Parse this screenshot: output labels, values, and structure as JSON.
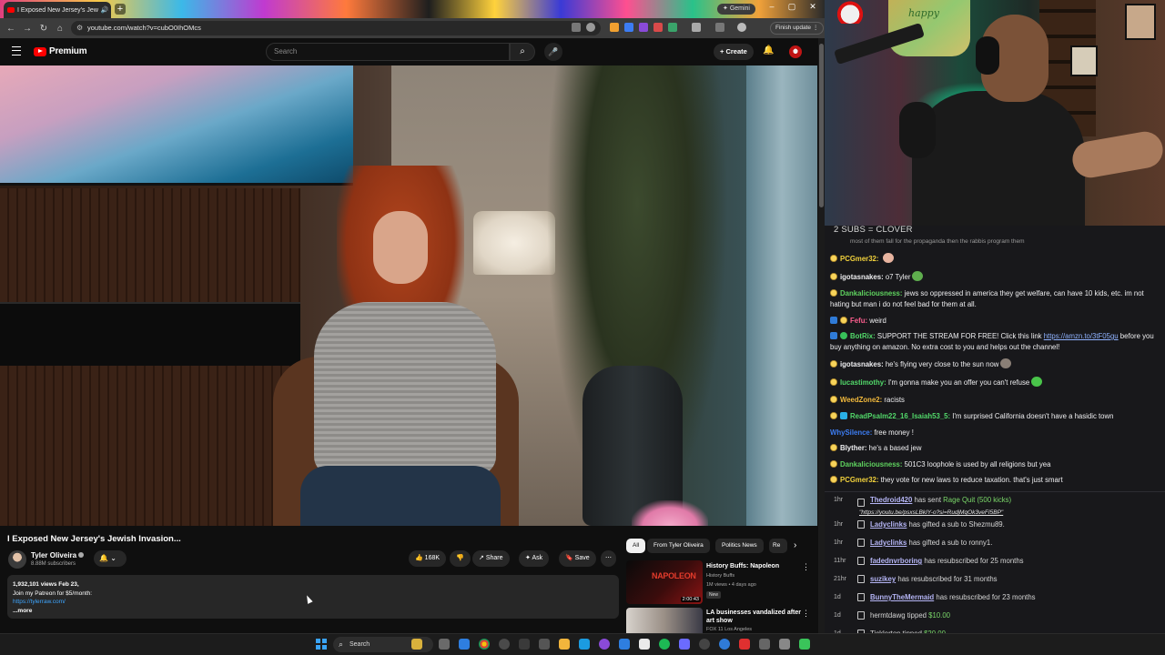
{
  "browser": {
    "tab_title": "I Exposed New Jersey's Jew",
    "url": "youtube.com/watch?v=cubO0IhOMcs",
    "gemini_label": "Gemini",
    "finish_update_label": "Finish update"
  },
  "youtube": {
    "logo_text": "Premium",
    "search_placeholder": "Search",
    "create_label": "Create",
    "video_title": "I Exposed New Jersey's Jewish Invasion...",
    "channel_name": "Tyler Oliveira",
    "channel_subs": "8.88M subscribers",
    "actions": {
      "likes": "168K",
      "share": "Share",
      "ask": "Ask",
      "save": "Save"
    },
    "description": {
      "meta": "1,932,101 views  Feb 23,",
      "line1": "Join my Patreon for $5/month:",
      "link": "https://tylerraw.com/",
      "more": "...more"
    },
    "chips": [
      "All",
      "From Tyler Oliveira",
      "Politics News",
      "Re"
    ],
    "recommendations": [
      {
        "title": "History Buffs: Napoleon",
        "channel": "History Buffs",
        "meta": "1M views • 4 days ago",
        "badge": "New",
        "duration": "2:00:43",
        "thumb_text": "NAPOLEON"
      },
      {
        "title": "LA businesses vandalized after art show",
        "channel": "FOX 11 Los Angeles",
        "meta": "",
        "badge": "",
        "duration": "",
        "thumb_text": ""
      }
    ]
  },
  "stream": {
    "webcam_sign": "happy",
    "chat_header": "2 SUBS = CLOVER",
    "clipped_line": "most of them fall for the propaganda then the rabbis program them",
    "messages": [
      {
        "badges": [
          "gold"
        ],
        "user": "PCGmer32:",
        "color": "#f2d23c",
        "text": "",
        "emote": "#e8b4a0"
      },
      {
        "badges": [
          "gold"
        ],
        "user": "igotasnakes:",
        "color": "#efeff1",
        "text": "o7 Tyler",
        "emote": "#5fae4e"
      },
      {
        "badges": [
          "gold"
        ],
        "user": "Dankaliciousness:",
        "color": "#5fd35f",
        "text": "jews so oppressed in america they get welfare, can have 10 kids, etc. im not hating but man i do not feel bad for them at all.",
        "emote": ""
      },
      {
        "badges": [
          "blue",
          "gold"
        ],
        "user": "Fefu:",
        "color": "#ff5f8f",
        "text": "weird",
        "emote": ""
      },
      {
        "badges": [
          "blue",
          "green"
        ],
        "user": "BotRix:",
        "color": "#52d96a",
        "text": "SUPPORT THE STREAM FOR FREE! Click this link ",
        "link": "https://amzn.to/3tF05gu",
        "text2": " before you buy anything on amazon. No extra cost to you and helps out the channel!",
        "emote": ""
      },
      {
        "badges": [
          "gold"
        ],
        "user": "igotasnakes:",
        "color": "#efeff1",
        "text": "he's flying very close to the sun now",
        "emote": "#8a7f76"
      },
      {
        "badges": [
          "gold"
        ],
        "user": "lucastimothy:",
        "color": "#52d96a",
        "text": "I'm gonna make you an offer you can't refuse",
        "emote": "#49c44a"
      },
      {
        "badges": [
          "gold"
        ],
        "user": "WeedZone2:",
        "color": "#f2b93c",
        "text": "racists",
        "emote": ""
      },
      {
        "badges": [
          "gold",
          "cyan"
        ],
        "user": "ReadPsalm22_16_Isaiah53_5:",
        "color": "#52d96a",
        "text": "I'm surprised California doesn't have a hasidic town",
        "emote": ""
      },
      {
        "badges": [],
        "user": "WhySilence:",
        "color": "#3c7cf2",
        "text": "free money !",
        "emote": ""
      },
      {
        "badges": [
          "gold"
        ],
        "user": "Blyther:",
        "color": "#efeff1",
        "text": "he's a based jew",
        "emote": ""
      },
      {
        "badges": [
          "gold"
        ],
        "user": "Dankaliciousness:",
        "color": "#5fd35f",
        "text": "501C3 loophole is used by all religions but yea",
        "emote": ""
      },
      {
        "badges": [
          "gold"
        ],
        "user": "PCGmer32:",
        "color": "#f2d23c",
        "text": "they vote for new laws to reduce taxation. that's just smart",
        "emote": ""
      }
    ],
    "events": [
      {
        "time": "1hr",
        "user": "Thedroid420",
        "before": "",
        "text": " has sent ",
        "highlight": "Rage Quit (500 kicks)",
        "sub": "\"https://youtu.be/psxsLBkIY-o?si=RudjMqOk3veFI5BP\""
      },
      {
        "time": "1hr",
        "user": "Ladyclinks",
        "before": "",
        "text": " has gifted a sub to Shezmu89.",
        "highlight": "",
        "sub": ""
      },
      {
        "time": "1hr",
        "user": "Ladyclinks",
        "before": "",
        "text": " has gifted a sub to ronny1.",
        "highlight": "",
        "sub": ""
      },
      {
        "time": "11hr",
        "user": "fadednvrboring",
        "before": "",
        "text": " has resubscribed for 25 months",
        "highlight": "",
        "sub": ""
      },
      {
        "time": "21hr",
        "user": "suzikey",
        "before": "",
        "text": " has resubscribed for 31 months",
        "highlight": "",
        "sub": ""
      },
      {
        "time": "1d",
        "user": "BunnyTheMermaid",
        "before": "",
        "text": " has resubscribed for 23 months",
        "highlight": "",
        "sub": ""
      },
      {
        "time": "1d",
        "user": "",
        "before": "hermtdawg",
        "text": " tipped ",
        "highlight": "$10.00",
        "sub": ""
      },
      {
        "time": "1d",
        "user": "",
        "before": "Ticklerton",
        "text": " tipped ",
        "highlight": "$20.00",
        "sub": ""
      }
    ]
  },
  "taskbar": {
    "search_label": "Search"
  }
}
